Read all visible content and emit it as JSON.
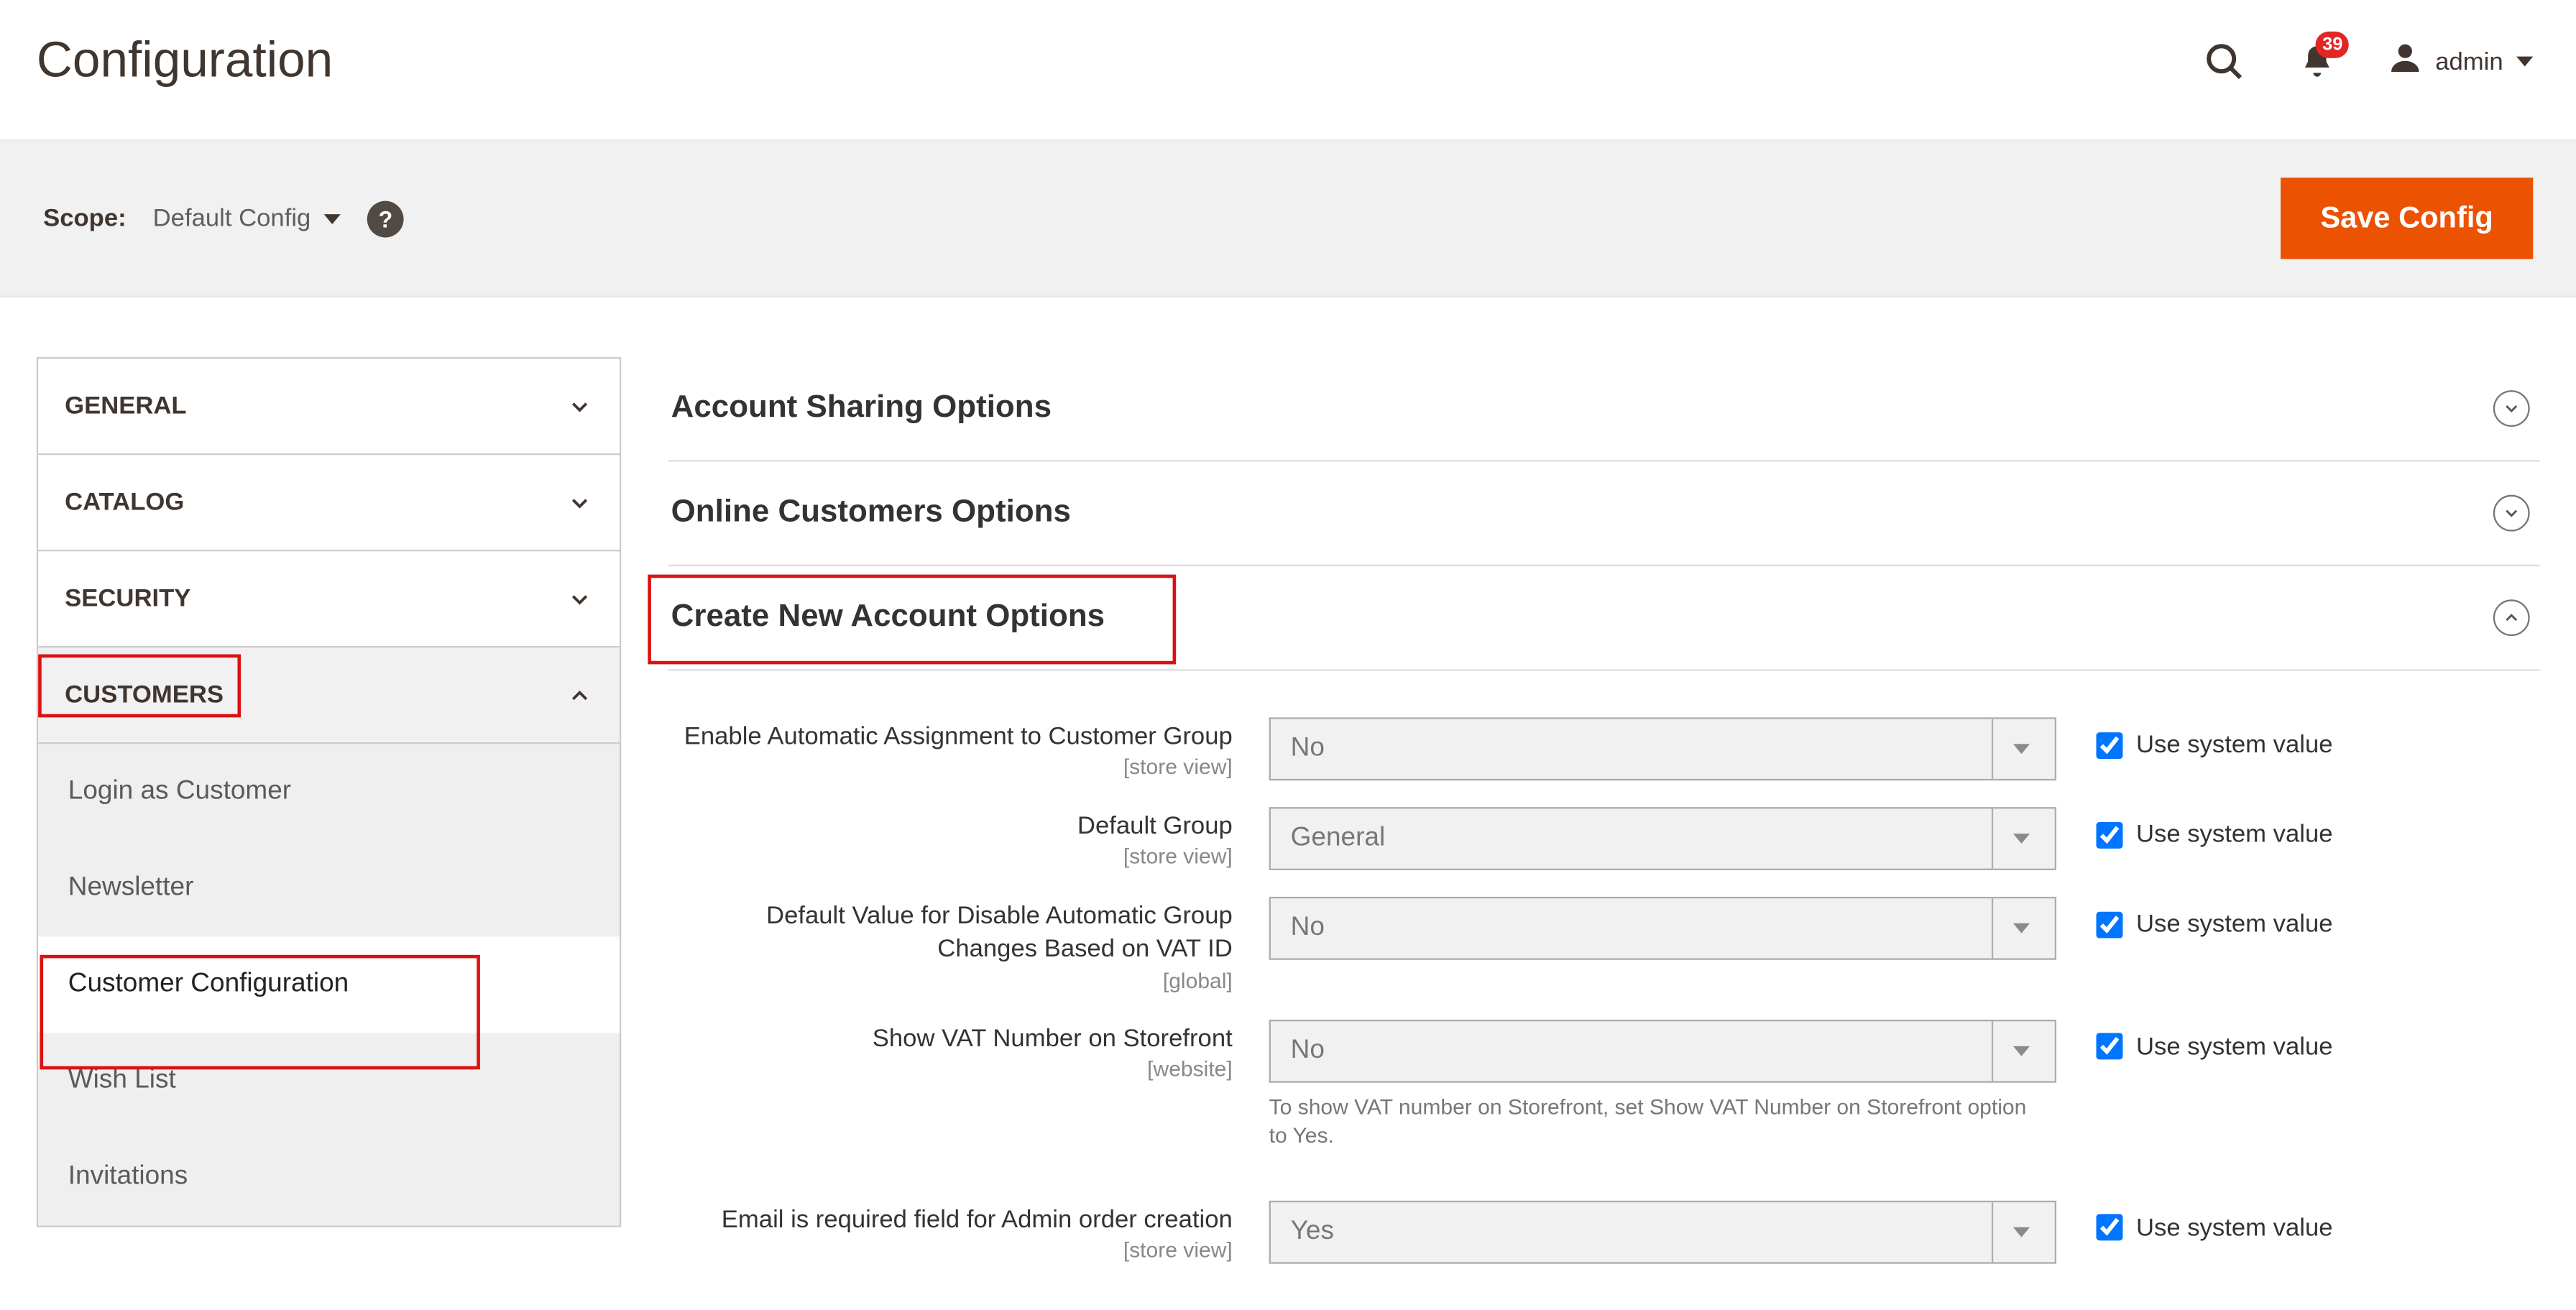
{
  "header": {
    "title": "Configuration",
    "notifications_count": "39",
    "user": "admin"
  },
  "actionbar": {
    "scope_label": "Scope:",
    "scope_value": "Default Config",
    "save_label": "Save Config"
  },
  "sidebar": {
    "groups": [
      {
        "label": "General",
        "open": false
      },
      {
        "label": "Catalog",
        "open": false
      },
      {
        "label": "Security",
        "open": false
      },
      {
        "label": "Customers",
        "open": true
      }
    ],
    "customer_items": [
      {
        "label": "Login as Customer",
        "active": false
      },
      {
        "label": "Newsletter",
        "active": false
      },
      {
        "label": "Customer Configuration",
        "active": true
      },
      {
        "label": "Wish List",
        "active": false
      },
      {
        "label": "Invitations",
        "active": false
      }
    ]
  },
  "sections": [
    {
      "title": "Account Sharing Options",
      "open": false
    },
    {
      "title": "Online Customers Options",
      "open": false
    },
    {
      "title": "Create New Account Options",
      "open": true
    }
  ],
  "form": {
    "use_system_label": "Use system value",
    "rows": [
      {
        "label": "Enable Automatic Assignment to Customer Group",
        "scope": "[store view]",
        "value": "No",
        "use_system": true,
        "hint": ""
      },
      {
        "label": "Default Group",
        "scope": "[store view]",
        "value": "General",
        "use_system": true,
        "hint": ""
      },
      {
        "label": "Default Value for Disable Automatic Group Changes Based on VAT ID",
        "scope": "[global]",
        "value": "No",
        "use_system": true,
        "hint": ""
      },
      {
        "label": "Show VAT Number on Storefront",
        "scope": "[website]",
        "value": "No",
        "use_system": true,
        "hint": "To show VAT number on Storefront, set Show VAT Number on Storefront option to Yes."
      },
      {
        "label": "Email is required field for Admin order creation",
        "scope": "[store view]",
        "value": "Yes",
        "use_system": true,
        "hint": ""
      }
    ]
  }
}
